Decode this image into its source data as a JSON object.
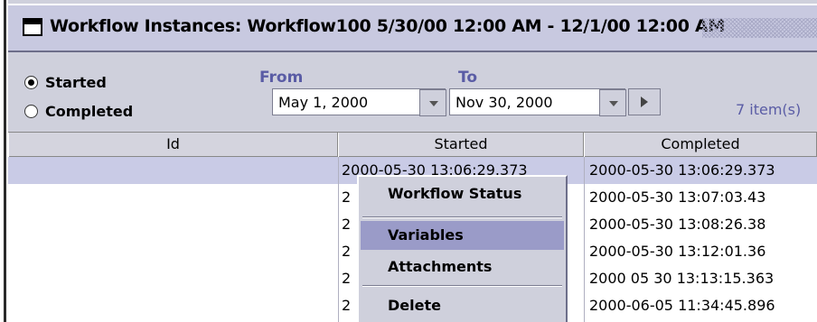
{
  "window": {
    "title": "Workflow Instances: Workflow100 5/30/00 12:00 AM - 12/1/00 12:00 AM"
  },
  "filters": {
    "radio_started": "Started",
    "radio_completed": "Completed",
    "selected": "Started",
    "from_label": "From",
    "to_label": "To",
    "from_value": "May 1, 2000",
    "to_value": "Nov 30, 2000",
    "item_count": "7  item(s)"
  },
  "table": {
    "columns": [
      "Id",
      "Started",
      "Completed"
    ],
    "rows": [
      {
        "id": "",
        "started": "2000-05-30 13:06:29.373",
        "completed": "2000-05-30 13:06:29.373"
      },
      {
        "id": "",
        "started": "2",
        "completed": "2000-05-30 13:07:03.43"
      },
      {
        "id": "",
        "started": "2",
        "completed": "2000-05-30 13:08:26.38"
      },
      {
        "id": "",
        "started": "2",
        "completed": "2000-05-30 13:12:01.36"
      },
      {
        "id": "",
        "started": "2",
        "completed": "2000 05 30 13:13:15.363"
      },
      {
        "id": "",
        "started": "2",
        "completed": "2000-06-05 11:34:45.896"
      }
    ]
  },
  "context_menu": {
    "items": [
      "Workflow Status",
      "Variables",
      "Attachments",
      "Delete"
    ],
    "highlighted": "Variables"
  }
}
